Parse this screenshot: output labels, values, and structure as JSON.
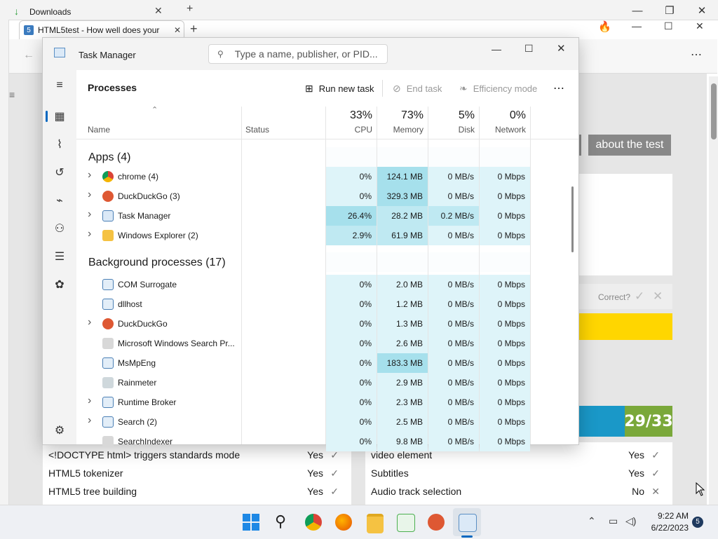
{
  "downloads_window": {
    "tab_title": "Downloads"
  },
  "browser": {
    "tab_title": "HTML5test - How well does your",
    "nav_about": "about the test",
    "correct_label": "Correct?",
    "score": "29/33",
    "features_left": [
      {
        "label": "<!DOCTYPE html> triggers standards mode",
        "value": "Yes"
      },
      {
        "label": "HTML5 tokenizer",
        "value": "Yes"
      },
      {
        "label": "HTML5 tree building",
        "value": "Yes"
      }
    ],
    "features_right": [
      {
        "label": "video element",
        "value": "Yes"
      },
      {
        "label": "Subtitles",
        "value": "Yes"
      },
      {
        "label": "Audio track selection",
        "value": "No"
      }
    ]
  },
  "task_manager": {
    "title": "Task Manager",
    "search_placeholder": "Type a name, publisher, or PID...",
    "page_title": "Processes",
    "commands": {
      "run_new_task": "Run new task",
      "end_task": "End task",
      "efficiency_mode": "Efficiency mode"
    },
    "columns": {
      "name": "Name",
      "status": "Status",
      "cpu": {
        "pct": "33%",
        "label": "CPU"
      },
      "memory": {
        "pct": "73%",
        "label": "Memory"
      },
      "disk": {
        "pct": "5%",
        "label": "Disk"
      },
      "network": {
        "pct": "0%",
        "label": "Network"
      }
    },
    "groups": {
      "apps": "Apps (4)",
      "background": "Background processes (17)"
    },
    "apps": [
      {
        "name": "chrome (4)",
        "cpu": "0%",
        "memory": "124.1 MB",
        "disk": "0 MB/s",
        "network": "0 Mbps",
        "expand": true,
        "icon": "chrome-icon"
      },
      {
        "name": "DuckDuckGo (3)",
        "cpu": "0%",
        "memory": "329.3 MB",
        "disk": "0 MB/s",
        "network": "0 Mbps",
        "expand": true,
        "icon": "duckduckgo-icon"
      },
      {
        "name": "Task Manager",
        "cpu": "26.4%",
        "memory": "28.2 MB",
        "disk": "0.2 MB/s",
        "network": "0 Mbps",
        "expand": true,
        "icon": "task-manager-icon"
      },
      {
        "name": "Windows Explorer (2)",
        "cpu": "2.9%",
        "memory": "61.9 MB",
        "disk": "0 MB/s",
        "network": "0 Mbps",
        "expand": true,
        "icon": "folder-icon"
      }
    ],
    "background": [
      {
        "name": "COM Surrogate",
        "cpu": "0%",
        "memory": "2.0 MB",
        "disk": "0 MB/s",
        "network": "0 Mbps",
        "expand": false,
        "icon": "service-icon"
      },
      {
        "name": "dllhost",
        "cpu": "0%",
        "memory": "1.2 MB",
        "disk": "0 MB/s",
        "network": "0 Mbps",
        "expand": false,
        "icon": "service-icon"
      },
      {
        "name": "DuckDuckGo",
        "cpu": "0%",
        "memory": "1.3 MB",
        "disk": "0 MB/s",
        "network": "0 Mbps",
        "expand": true,
        "icon": "duckduckgo-icon"
      },
      {
        "name": "Microsoft Windows Search Pr...",
        "cpu": "0%",
        "memory": "2.6 MB",
        "disk": "0 MB/s",
        "network": "0 Mbps",
        "expand": false,
        "icon": "search-process-icon"
      },
      {
        "name": "MsMpEng",
        "cpu": "0%",
        "memory": "183.3 MB",
        "disk": "0 MB/s",
        "network": "0 Mbps",
        "expand": false,
        "icon": "service-icon"
      },
      {
        "name": "Rainmeter",
        "cpu": "0%",
        "memory": "2.9 MB",
        "disk": "0 MB/s",
        "network": "0 Mbps",
        "expand": false,
        "icon": "rainmeter-icon"
      },
      {
        "name": "Runtime Broker",
        "cpu": "0%",
        "memory": "2.3 MB",
        "disk": "0 MB/s",
        "network": "0 Mbps",
        "expand": true,
        "icon": "service-icon"
      },
      {
        "name": "Search (2)",
        "cpu": "0%",
        "memory": "2.5 MB",
        "disk": "0 MB/s",
        "network": "0 Mbps",
        "expand": true,
        "icon": "service-icon"
      },
      {
        "name": "SearchIndexer",
        "cpu": "0%",
        "memory": "9.8 MB",
        "disk": "0 MB/s",
        "network": "0 Mbps",
        "expand": false,
        "icon": "search-process-icon"
      }
    ]
  },
  "taskbar": {
    "time": "9:22 AM",
    "date": "6/22/2023",
    "notification_count": "5"
  },
  "colors": {
    "heat_low": "#def4f9",
    "heat_mid": "#bfe9f2",
    "heat_high": "#a6e0ec",
    "score_green": "#7aa83a",
    "bar_blue": "#1a98c8",
    "yellow": "#ffd600"
  }
}
